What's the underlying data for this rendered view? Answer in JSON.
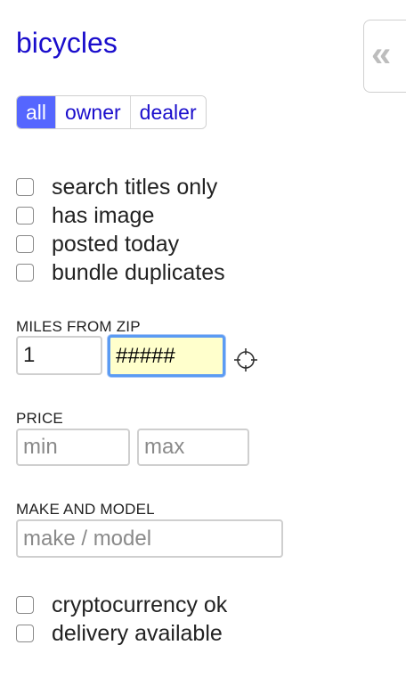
{
  "title": "bicycles",
  "collapse_icon": "double-chevron-left-icon",
  "seller_tabs": [
    {
      "label": "all",
      "active": true
    },
    {
      "label": "owner",
      "active": false
    },
    {
      "label": "dealer",
      "active": false
    }
  ],
  "filters": [
    {
      "label": "search titles only",
      "checked": false
    },
    {
      "label": "has image",
      "checked": false
    },
    {
      "label": "posted today",
      "checked": false
    },
    {
      "label": "bundle duplicates",
      "checked": false
    }
  ],
  "miles": {
    "label": "MILES FROM ZIP",
    "distance_value": "1",
    "zip_value": "#####",
    "locate_icon": "crosshair-icon"
  },
  "price": {
    "label": "PRICE",
    "min_placeholder": "min",
    "max_placeholder": "max"
  },
  "make_model": {
    "label": "MAKE AND MODEL",
    "placeholder": "make / model"
  },
  "extra_filters": [
    {
      "label": "cryptocurrency ok",
      "checked": false
    },
    {
      "label": "delivery available",
      "checked": false
    }
  ]
}
